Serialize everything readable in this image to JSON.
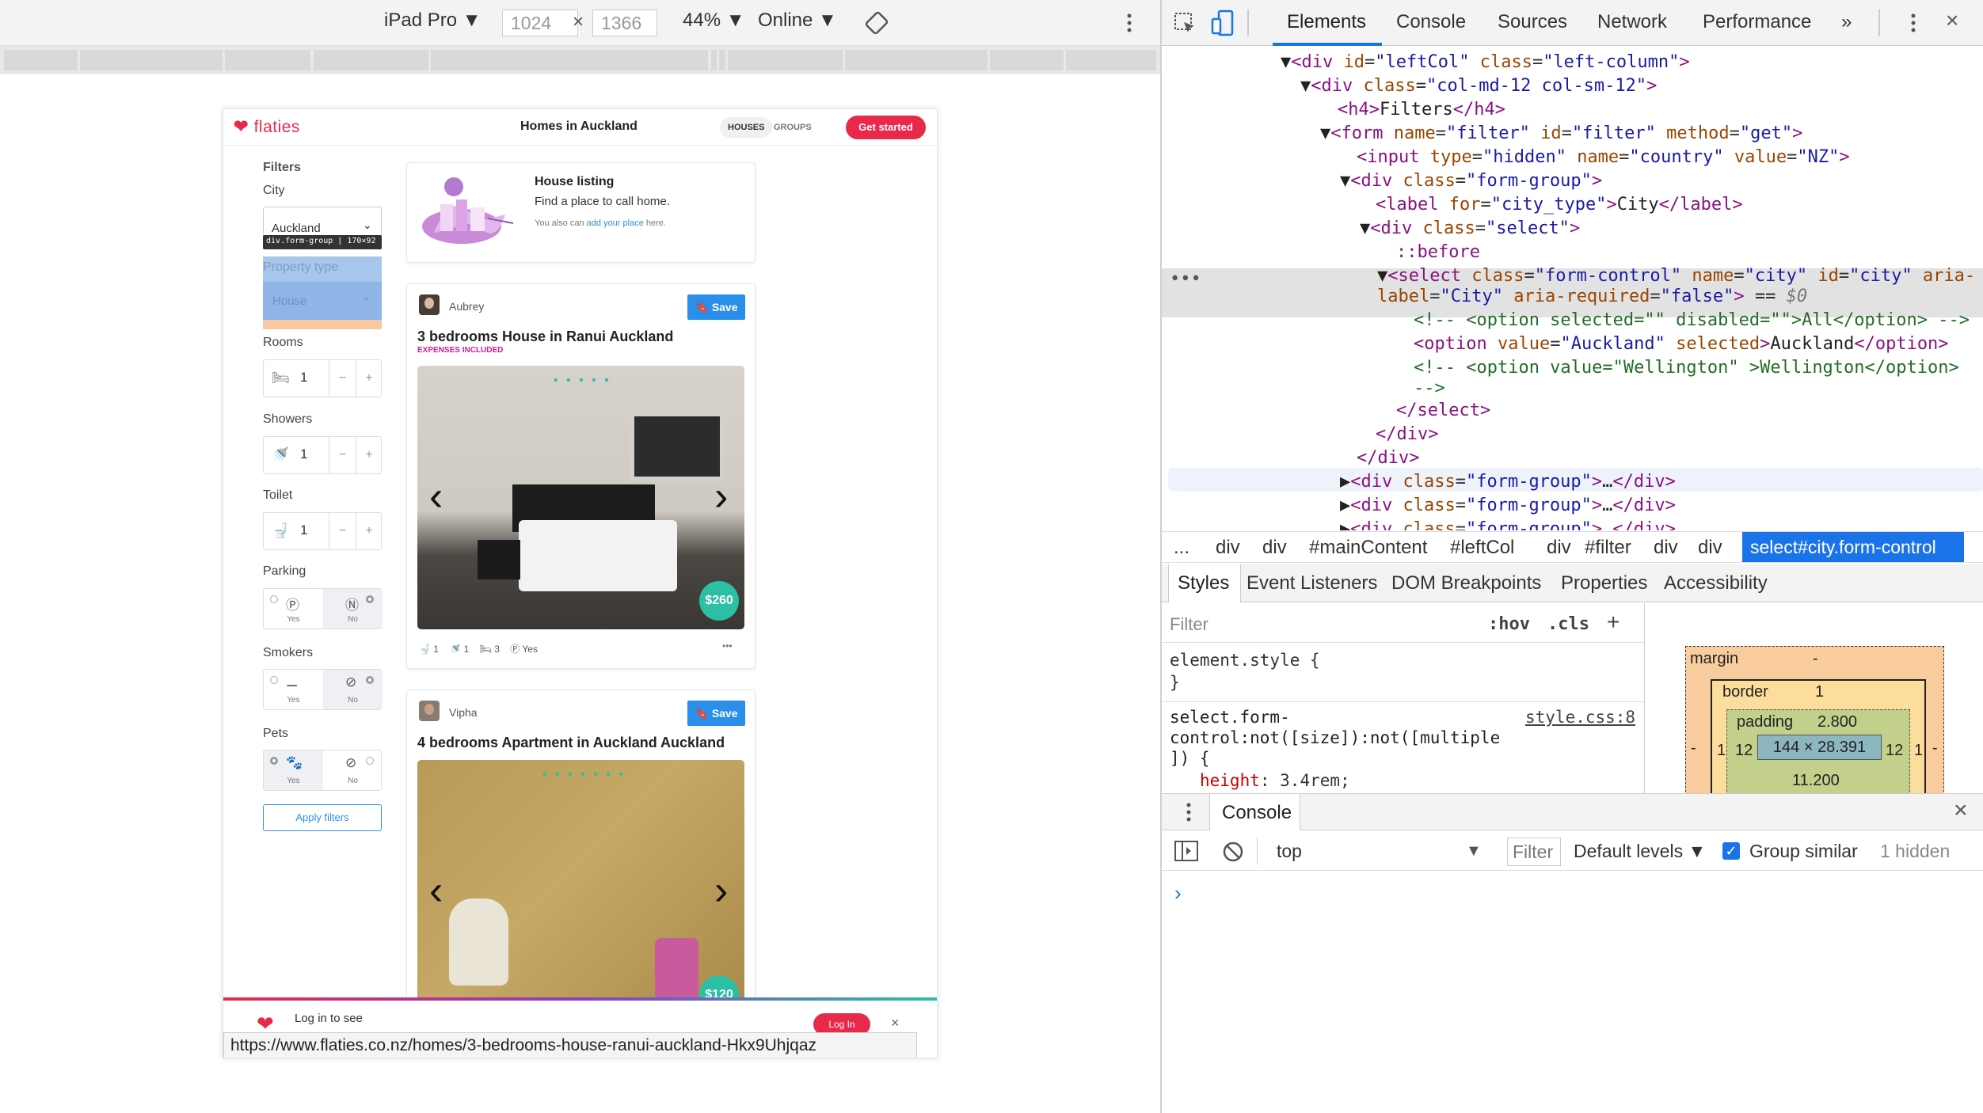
{
  "device_toolbar": {
    "device": "iPad Pro",
    "width": "1024",
    "height": "1366",
    "times": "×",
    "zoom": "44%",
    "network": "Online",
    "dropdown_arrow": "▼"
  },
  "page": {
    "logo": "flaties",
    "title": "Homes in Auckland",
    "nav": {
      "houses": "HOUSES",
      "groups": "GROUPS",
      "get_started": "Get started"
    },
    "filters": {
      "heading": "Filters",
      "city_label": "City",
      "city_value": "Auckland",
      "tooltip": "div.form-group | 170×92",
      "property_type_label": "Property type",
      "property_type_value": "House",
      "rooms_label": "Rooms",
      "rooms_value": "1",
      "showers_label": "Showers",
      "showers_value": "1",
      "toilet_label": "Toilet",
      "toilet_value": "1",
      "minus": "−",
      "plus": "+",
      "parking_label": "Parking",
      "smokers_label": "Smokers",
      "pets_label": "Pets",
      "yes": "Yes",
      "no": "No",
      "apply": "Apply filters"
    },
    "listing_promo": {
      "title": "House listing",
      "subtitle": "Find a place to call home.",
      "note_prefix": "You also can ",
      "note_link": "add your place",
      "note_suffix": " here."
    },
    "cards": [
      {
        "user": "Aubrey",
        "save": "Save",
        "title": "3 bedrooms House in Ranui Auckland",
        "tag": "EXPENSES INCLUDED",
        "price": "$260",
        "toilets": "1",
        "showers": "1",
        "rooms": "3",
        "parking": "Yes",
        "more": "•••"
      },
      {
        "user": "Vipha",
        "save": "Save",
        "title": "4 bedrooms Apartment in Auckland Auckland",
        "price": "$120"
      }
    ],
    "carousel_prev": "‹",
    "carousel_next": "›",
    "login_banner": {
      "text": "Log in to see",
      "button": "Log In",
      "close": "×"
    },
    "status_url": "https://www.flaties.co.nz/homes/3-bedrooms-house-ranui-auckland-Hkx9Uhjqaz"
  },
  "devtools": {
    "tabs": [
      "Elements",
      "Console",
      "Sources",
      "Network",
      "Performance",
      "»"
    ],
    "active_tab": "Elements",
    "breadcrumbs": [
      "...",
      "div",
      "div",
      "#mainContent",
      "#leftCol",
      "div",
      "#filter",
      "div",
      "div",
      "select#city.form-control"
    ],
    "styles_tabs": [
      "Styles",
      "Event Listeners",
      "DOM Breakpoints",
      "Properties",
      "Accessibility"
    ],
    "styles": {
      "filter_placeholder": "Filter",
      "hov": ":hov",
      "cls": ".cls",
      "plus": "+",
      "element_style": "element.style {",
      "close_brace": "}",
      "rule_selector_1": "select.form-",
      "rule_selector_2": "control:not([size]):not([multiple",
      "rule_selector_3": "]) {",
      "rule_source": "style.css:8",
      "rule_prop": "height",
      "rule_value": "3.4rem;"
    },
    "boxmodel": {
      "margin": "margin",
      "margin_value": "-",
      "border": "border",
      "border_value": "1",
      "padding": "padding",
      "padding_value": "2.800",
      "content": "144 × 28.391",
      "left_padding": "12",
      "right_padding": "12",
      "left_border": "1",
      "right_border": "1",
      "left_margin": "-",
      "right_margin": "-",
      "bottom_padding": "11.200"
    },
    "drawer": {
      "title": "Console",
      "context": "top",
      "filter": "Filter",
      "levels": "Default levels",
      "group_similar": "Group similar",
      "hidden": "1 hidden",
      "prompt": "›",
      "close": "×"
    },
    "dom_lines": [
      "div id=\"leftCol\" class=\"left-column\"",
      "div class=\"col-md-12 col-sm-12\""
    ]
  }
}
